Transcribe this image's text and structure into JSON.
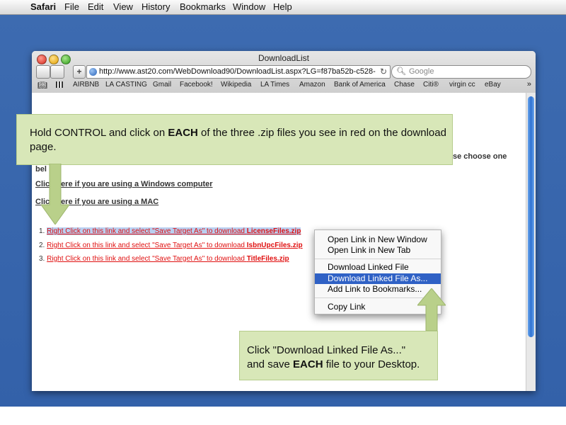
{
  "menubar": {
    "app": "Safari",
    "items": [
      "File",
      "Edit",
      "View",
      "History",
      "Bookmarks",
      "Window",
      "Help"
    ]
  },
  "window": {
    "title": "DownloadList",
    "url": "http://www.ast20.com/WebDownload90/DownloadList.aspx?LG=f87ba52b-c528-",
    "search_placeholder": "Google",
    "bookmarks": [
      "AIRBNB",
      "LA CASTING",
      "Gmail",
      "Facebook!",
      "Wikipedia",
      "LA Times",
      "Amazon",
      "Bank of America",
      "Chase",
      "Citi®",
      "virgin cc",
      "eBay"
    ]
  },
  "page": {
    "partial_text_right": "se choose one",
    "partial_text_left": "bel",
    "windows_link": "Click here if you are using a Windows computer",
    "mac_link": "Click here if you are using a MAC",
    "downloads": [
      {
        "num": "1.",
        "text": "Right Click on this link and select \"Save Target As\" to download ",
        "file": "LicenseFiles.zip"
      },
      {
        "num": "2.",
        "text": "Right Click on this link and select \"Save Target As\" to download ",
        "file": "IsbnUpcFiles.zip"
      },
      {
        "num": "3.",
        "text": "Right Click on this link and select \"Save Target As\" to download ",
        "file": "TitleFiles.zip"
      }
    ]
  },
  "context_menu": {
    "items": [
      "Open Link in New Window",
      "Open Link in New Tab",
      "Download Linked File",
      "Download Linked File As...",
      "Add Link to Bookmarks...",
      "Copy Link"
    ],
    "highlighted": "Download Linked File As..."
  },
  "callouts": {
    "top_pre": "Hold CONTROL and click on ",
    "top_bold": "EACH",
    "top_post": " of the three .zip files you see in red on the download page.",
    "bottom_line1": "Click \"Download Linked File As...\"",
    "bottom_pre": "and save ",
    "bottom_bold": "EACH",
    "bottom_post": " file to your Desktop."
  },
  "colors": {
    "desktop": "#3361a9",
    "callout": "#d8e7b8",
    "link_red": "#e01010",
    "menu_highlight": "#2f61c5"
  }
}
